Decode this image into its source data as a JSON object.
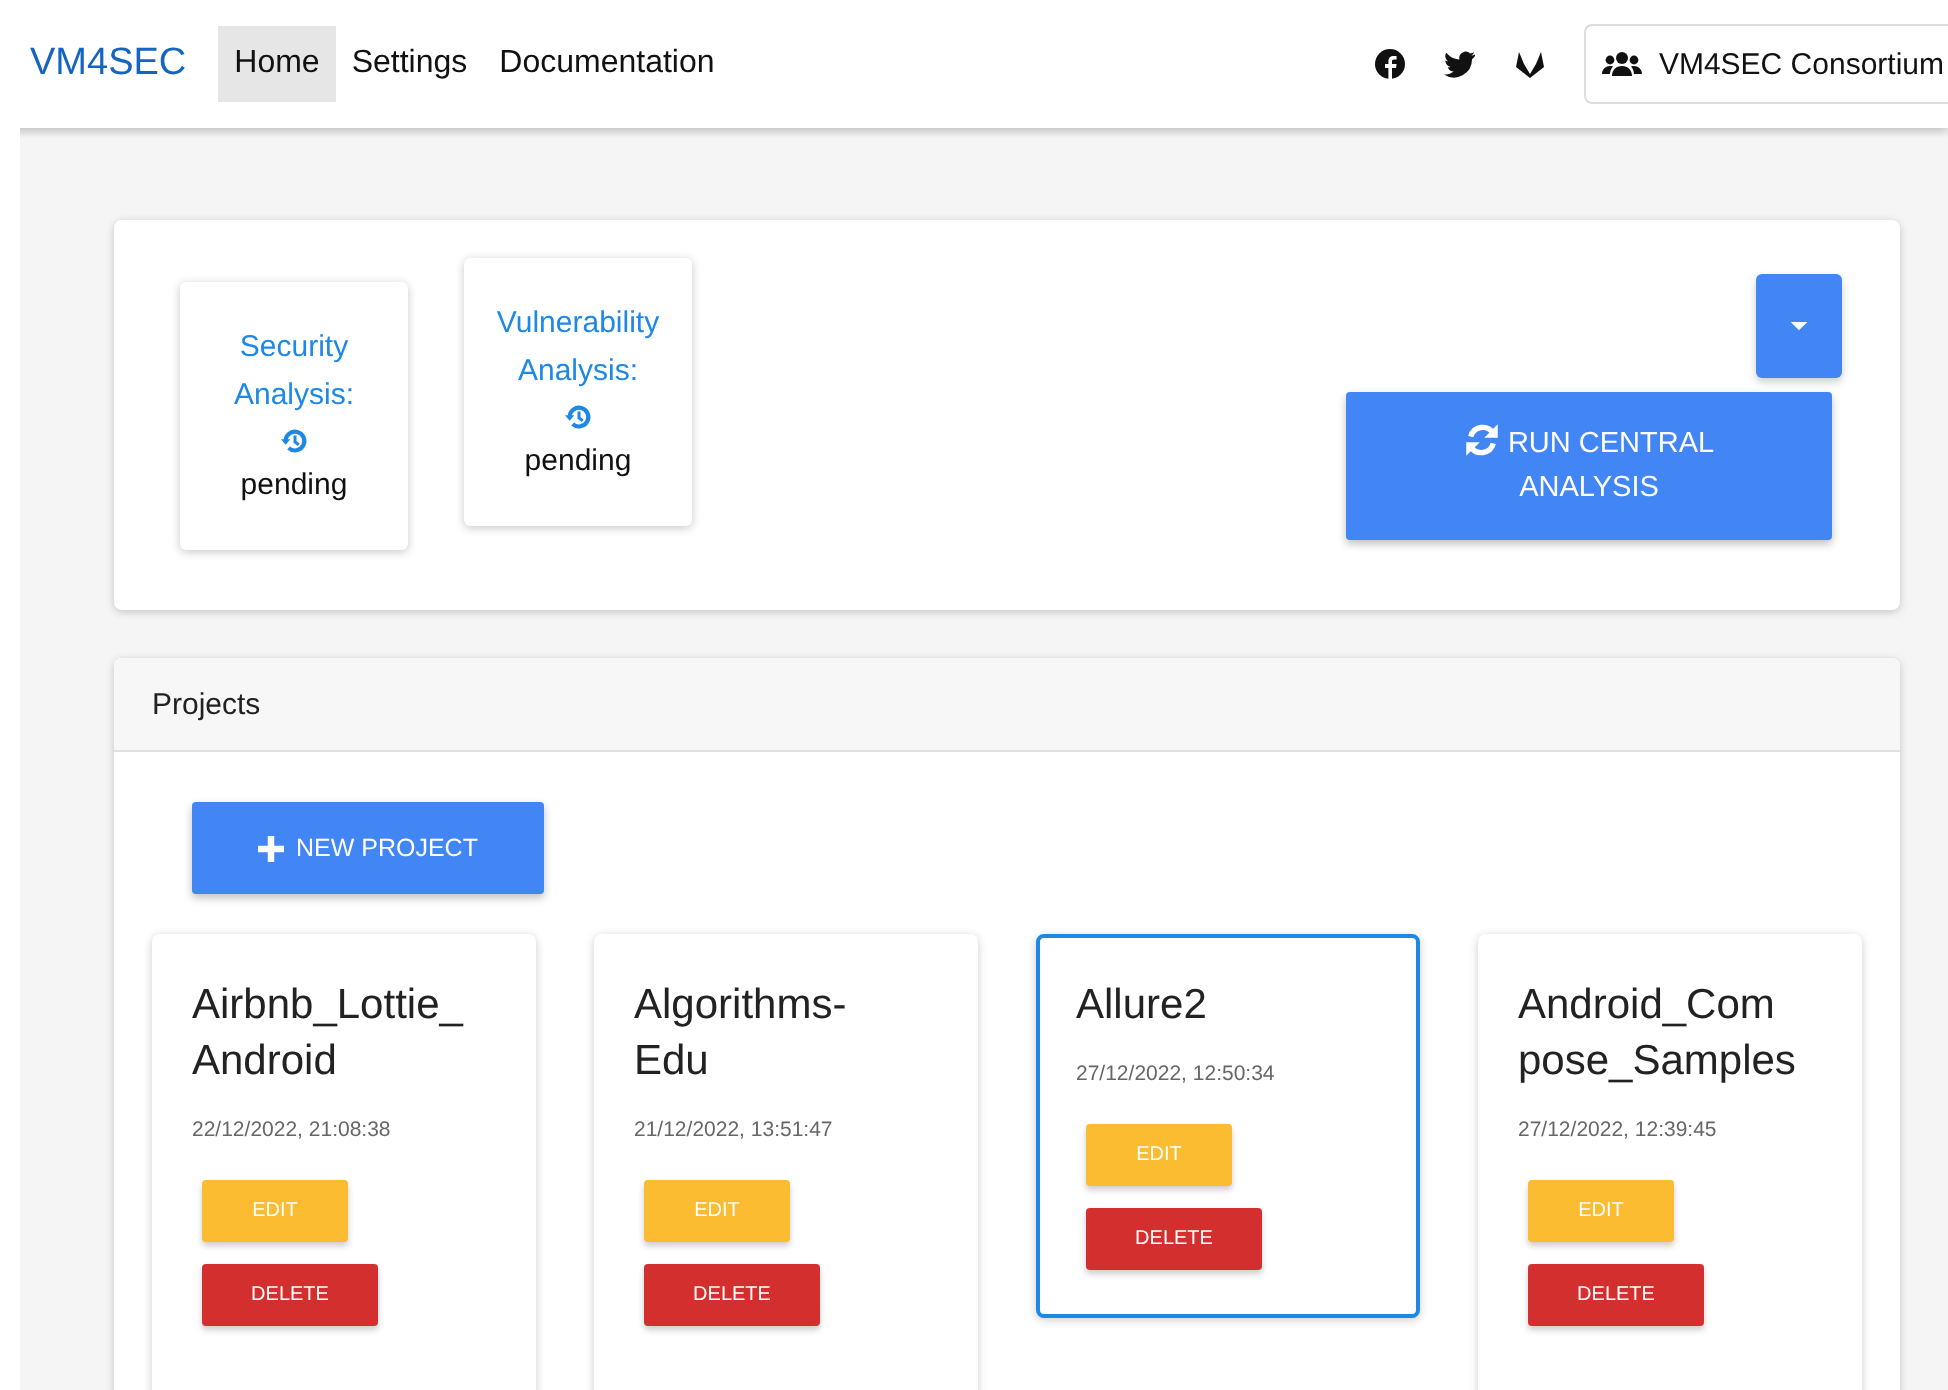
{
  "navbar": {
    "brand": "VM4SEC",
    "links": [
      {
        "label": "Home",
        "selected": true
      },
      {
        "label": "Settings",
        "selected": false
      },
      {
        "label": "Documentation",
        "selected": false
      }
    ],
    "account": "VM4SEC Consortium"
  },
  "analyses": [
    {
      "title": "Security Analysis:",
      "status": "pending"
    },
    {
      "title": "Vulnerability Analysis:",
      "status": "pending"
    }
  ],
  "run_button": "RUN CENTRAL ANALYSIS",
  "projects": {
    "header": "Projects",
    "new_button": "NEW PROJECT",
    "items": [
      {
        "name": "Airbnb_Lottie_Android",
        "date": "22/12/2022, 21:08:38",
        "selected": false,
        "edit": "EDIT",
        "delete": "DELETE"
      },
      {
        "name": "Algorithms-Edu",
        "date": "21/12/2022, 13:51:47",
        "selected": false,
        "edit": "EDIT",
        "delete": "DELETE"
      },
      {
        "name": "Allure2",
        "date": "27/12/2022, 12:50:34",
        "selected": true,
        "edit": "EDIT",
        "delete": "DELETE"
      },
      {
        "name": "Android_Compose_Samples",
        "date": "27/12/2022, 12:39:45",
        "selected": false,
        "edit": "EDIT",
        "delete": "DELETE"
      }
    ]
  }
}
